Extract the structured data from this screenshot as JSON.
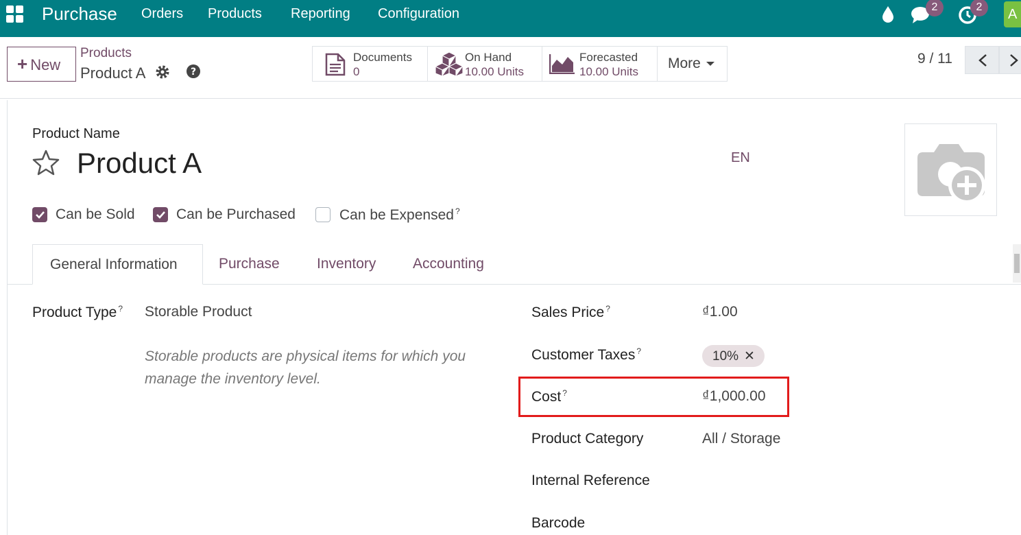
{
  "navbar": {
    "app_name": "Purchase",
    "menus": [
      "Orders",
      "Products",
      "Reporting",
      "Configuration"
    ],
    "messages_badge": "2",
    "activities_badge": "2",
    "avatar_initial": "A",
    "colors": {
      "bar": "#017e84",
      "badge": "#875a7b"
    }
  },
  "control": {
    "new_label": "New",
    "breadcrumb_parent": "Products",
    "breadcrumb_current": "Product A",
    "smart_buttons": {
      "documents": {
        "label": "Documents",
        "value": "0"
      },
      "on_hand": {
        "label": "On Hand",
        "value": "10.00 Units"
      },
      "forecasted": {
        "label": "Forecasted",
        "value": "10.00 Units"
      }
    },
    "more_label": "More",
    "pager": "9 / 11"
  },
  "form": {
    "name_label": "Product Name",
    "name": "Product A",
    "lang": "EN",
    "checkboxes": {
      "sold": {
        "label": "Can be Sold",
        "checked": true
      },
      "purchased": {
        "label": "Can be Purchased",
        "checked": true
      },
      "expensed": {
        "label": "Can be Expensed",
        "checked": false,
        "tooltip": "?"
      }
    },
    "tabs": [
      "General Information",
      "Purchase",
      "Inventory",
      "Accounting"
    ],
    "general": {
      "product_type_label": "Product Type",
      "product_type": "Storable Product",
      "product_type_help": "Storable products are physical items for which you manage the inventory level.",
      "sales_price_label": "Sales Price",
      "sales_price": "₫1.00",
      "customer_taxes_label": "Customer Taxes",
      "customer_tax": "10%",
      "cost_label": "Cost",
      "cost": "₫1,000.00",
      "category_label": "Product Category",
      "category": "All / Storage",
      "internal_ref_label": "Internal Reference",
      "barcode_label": "Barcode"
    },
    "tooltip_mark": "?",
    "accent": "#714b67"
  }
}
